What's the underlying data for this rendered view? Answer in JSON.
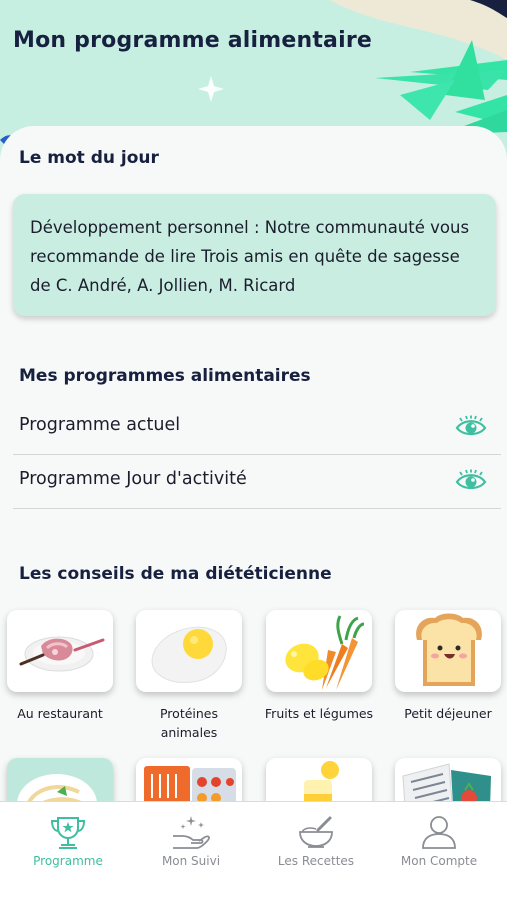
{
  "header": {
    "title": "Mon programme alimentaire"
  },
  "word_of_day": {
    "heading": "Le mot du jour",
    "lines": [
      "Développement personnel : Notre communauté vous",
      "recommande de lire Trois amis en quête de sagesse",
      "de C. André, A. Jollien, M. Ricard"
    ]
  },
  "programs": {
    "heading": "Mes programmes alimentaires",
    "items": [
      {
        "label": "Programme actuel",
        "icon": "eye-icon"
      },
      {
        "label": "Programme Jour d'activité",
        "icon": "eye-icon"
      }
    ]
  },
  "advice": {
    "heading": "Les conseils de ma diététicienne",
    "tiles": [
      {
        "label": "Au restaurant",
        "icon": "ham-plate-icon"
      },
      {
        "label_line1": "Protéines",
        "label_line2": "animales",
        "icon": "fried-egg-icon"
      },
      {
        "label": "Fruits et légumes",
        "icon": "lemon-carrot-icon"
      },
      {
        "label": "Petit déjeuner",
        "icon": "toast-icon"
      },
      {
        "label": "",
        "icon": "pasta-icon"
      },
      {
        "label": "",
        "icon": "pills-icon"
      },
      {
        "label": "",
        "icon": "juice-icon"
      },
      {
        "label": "",
        "icon": "book-icon"
      }
    ]
  },
  "nav": {
    "items": [
      {
        "label": "Programme",
        "icon": "trophy-icon",
        "active": true
      },
      {
        "label": "Mon Suivi",
        "icon": "hand-sparkle-icon",
        "active": false
      },
      {
        "label": "Les Recettes",
        "icon": "mortar-bowl-icon",
        "active": false
      },
      {
        "label": "Mon Compte",
        "icon": "user-icon",
        "active": false
      }
    ]
  },
  "colors": {
    "accent": "#3fbf9f",
    "hero_bg": "#c6efe2",
    "title_text": "#17213f",
    "card_bg": "#c9eee1",
    "inactive_nav": "#8a8d93"
  }
}
